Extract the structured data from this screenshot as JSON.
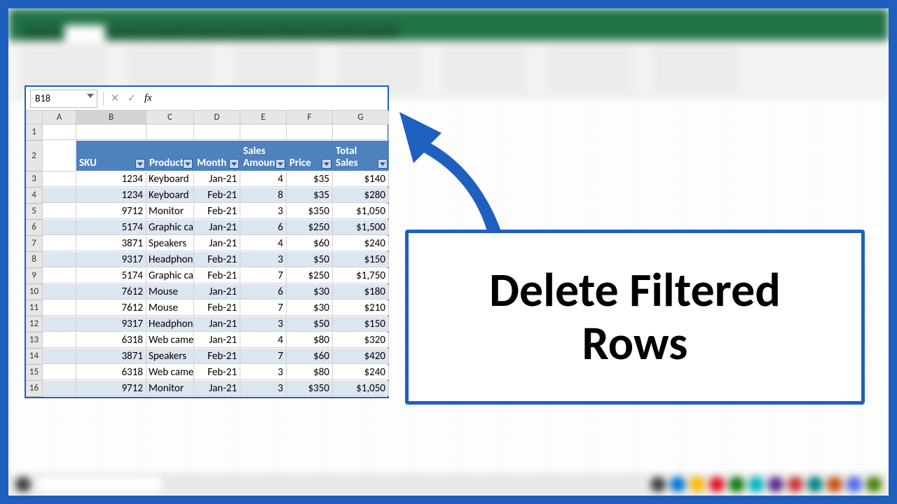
{
  "namebox": {
    "ref": "B18"
  },
  "formula_bar": {
    "fx_label": "fx",
    "value": ""
  },
  "columns": [
    "A",
    "B",
    "C",
    "D",
    "E",
    "F",
    "G"
  ],
  "row_headers": [
    1,
    2,
    3,
    4,
    5,
    6,
    7,
    8,
    9,
    10,
    11,
    12,
    13,
    14,
    15,
    16
  ],
  "table": {
    "headers": [
      "SKU",
      "Product",
      "Month",
      "Sales Amount",
      "Price",
      "Total Sales"
    ],
    "rows": [
      {
        "sku": "1234",
        "product": "Keyboard",
        "month": "Jan-21",
        "amount": "4",
        "price": "$35",
        "total": "$140"
      },
      {
        "sku": "1234",
        "product": "Keyboard",
        "month": "Feb-21",
        "amount": "8",
        "price": "$35",
        "total": "$280"
      },
      {
        "sku": "9712",
        "product": "Monitor",
        "month": "Feb-21",
        "amount": "3",
        "price": "$350",
        "total": "$1,050"
      },
      {
        "sku": "5174",
        "product": "Graphic card",
        "month": "Jan-21",
        "amount": "6",
        "price": "$250",
        "total": "$1,500"
      },
      {
        "sku": "3871",
        "product": "Speakers",
        "month": "Jan-21",
        "amount": "4",
        "price": "$60",
        "total": "$240"
      },
      {
        "sku": "9317",
        "product": "Headphones",
        "month": "Feb-21",
        "amount": "3",
        "price": "$50",
        "total": "$150"
      },
      {
        "sku": "5174",
        "product": "Graphic card",
        "month": "Feb-21",
        "amount": "7",
        "price": "$250",
        "total": "$1,750"
      },
      {
        "sku": "7612",
        "product": "Mouse",
        "month": "Jan-21",
        "amount": "6",
        "price": "$30",
        "total": "$180"
      },
      {
        "sku": "7612",
        "product": "Mouse",
        "month": "Feb-21",
        "amount": "7",
        "price": "$30",
        "total": "$210"
      },
      {
        "sku": "9317",
        "product": "Headphones",
        "month": "Jan-21",
        "amount": "3",
        "price": "$50",
        "total": "$150"
      },
      {
        "sku": "6318",
        "product": "Web camera",
        "month": "Jan-21",
        "amount": "4",
        "price": "$80",
        "total": "$320"
      },
      {
        "sku": "3871",
        "product": "Speakers",
        "month": "Feb-21",
        "amount": "7",
        "price": "$60",
        "total": "$420"
      },
      {
        "sku": "6318",
        "product": "Web camera",
        "month": "Feb-21",
        "amount": "3",
        "price": "$80",
        "total": "$240"
      },
      {
        "sku": "9712",
        "product": "Monitor",
        "month": "Jan-21",
        "amount": "3",
        "price": "$350",
        "total": "$1,050"
      }
    ]
  },
  "callout": {
    "line1": "Delete Filtered",
    "line2": "Rows"
  },
  "colors": {
    "accent": "#1f5fbf",
    "table_header": "#4f81bd",
    "stripe": "#dce6f1"
  },
  "taskbar_icons": [
    "#444",
    "#0078d4",
    "#ffb900",
    "#e81123",
    "#107c10",
    "#00b7c3",
    "#5c2d91",
    "#d13438",
    "#038387",
    "#ca5010",
    "#4f6bed",
    "#498205"
  ]
}
